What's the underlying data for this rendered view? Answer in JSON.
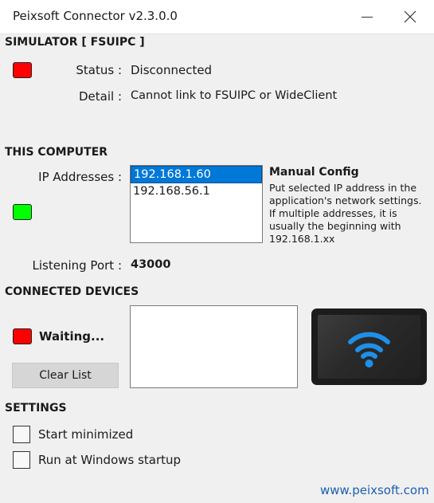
{
  "window": {
    "title": "Peixsoft Connector v2.3.0.0",
    "minimize_icon": "minimize-icon",
    "close_icon": "close-icon"
  },
  "simulator": {
    "heading": "SIMULATOR  [ FSUIPC ]",
    "led_color": "#ff0000",
    "status_label": "Status :",
    "status_value": "Disconnected",
    "detail_label": "Detail :",
    "detail_value": "Cannot link to FSUIPC or WideClient"
  },
  "computer": {
    "heading": "THIS COMPUTER",
    "ip_label": "IP Addresses :",
    "ip_addresses": [
      "192.168.1.60",
      "192.168.56.1"
    ],
    "selected_ip": "192.168.1.60",
    "led_color": "#00ff00",
    "manual_config_title": "Manual Config",
    "manual_config_text": "Put selected IP address in the application's network settings. If multiple addresses, it is usually the beginning with 192.168.1.xx",
    "port_label": "Listening Port :",
    "port_value": "43000"
  },
  "devices": {
    "heading": "CONNECTED DEVICES",
    "led_color": "#ff0000",
    "waiting_text": "Waiting...",
    "clear_button": "Clear List",
    "tablet_icon": "wifi-tablet-icon",
    "wifi_color": "#1e90e8"
  },
  "settings": {
    "heading": "SETTINGS",
    "start_minimized_label": "Start minimized",
    "start_minimized_checked": false,
    "run_startup_label": "Run at Windows startup",
    "run_startup_checked": false
  },
  "footer": {
    "link": "www.peixsoft.com"
  }
}
